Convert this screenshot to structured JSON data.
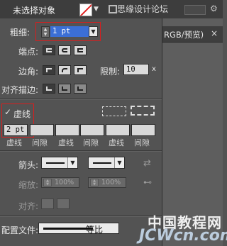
{
  "topbar": {
    "selection_status": "未选择对象",
    "fill_swatch": "none-red-slash",
    "watermark": "思缘设计论坛"
  },
  "document_tab": {
    "label": "RGB/预览)",
    "close": "×"
  },
  "stroke_panel": {
    "weight_label": "粗细:",
    "weight_value": "1 pt",
    "cap_label": "端点:",
    "corner_label": "边角:",
    "limit_label": "限制:",
    "limit_value": "10",
    "limit_unit": "x",
    "align_label": "对齐描边:",
    "dashed_label": "虚线",
    "dashed_checked": true,
    "dash_value_1": "2 pt",
    "dash_gap_labels": [
      "虚线",
      "间隙",
      "虚线",
      "间隙",
      "虚线",
      "间隙"
    ],
    "arrow_label": "箭头:",
    "scale_label": "缩放:",
    "scale_start": "100%",
    "scale_end": "100%",
    "align_arrow_label": "对齐:",
    "profile_label": "配置文件:",
    "profile_value": "等比"
  },
  "watermark_bottom": {
    "line1": "中国教程网",
    "line2": "JCWcn.com"
  },
  "colors": {
    "highlight": "#d81e1e",
    "selected_field": "#3b6fd6"
  }
}
